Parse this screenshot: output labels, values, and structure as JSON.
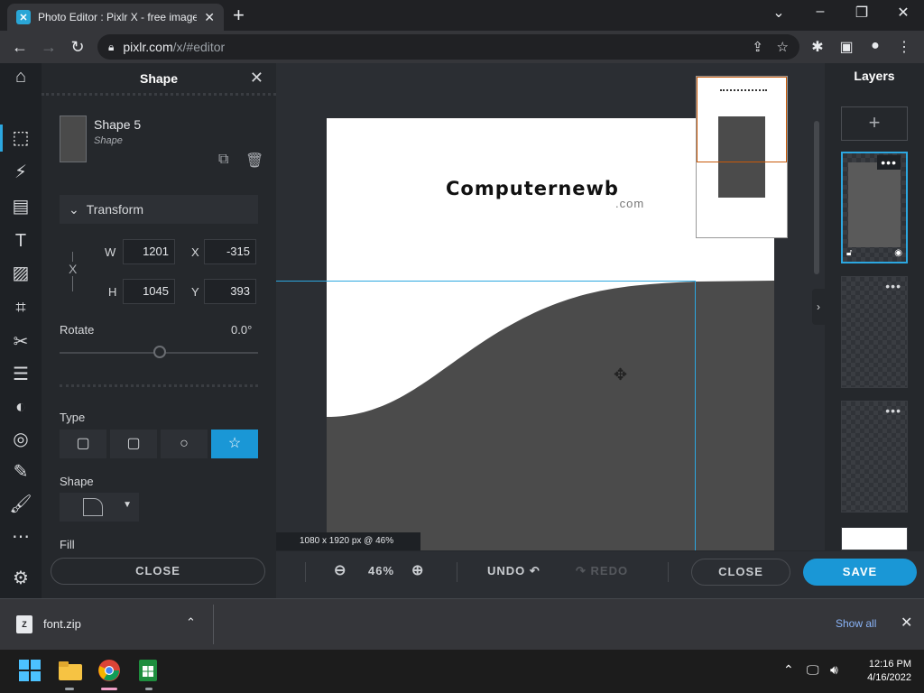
{
  "browser": {
    "tab_title": "Photo Editor : Pixlr X - free image",
    "url_host": "pixlr.com",
    "url_path": "/x/#editor"
  },
  "shape_panel": {
    "title": "Shape",
    "layer_name": "Shape 5",
    "layer_type": "Shape",
    "transform_label": "Transform",
    "w_label": "W",
    "w_value": "1201",
    "h_label": "H",
    "h_value": "1045",
    "x_label": "X",
    "x_value": "-315",
    "y_label": "Y",
    "y_value": "393",
    "link_label": "X",
    "rotate_label": "Rotate",
    "rotate_value": "0.0°",
    "type_label": "Type",
    "shape_label": "Shape",
    "fill_label": "Fill",
    "close_label": "CLOSE"
  },
  "canvas": {
    "logo_main": "Computernewb",
    "logo_sub": ".com",
    "size_info": "1080 x 1920 px @ 46%",
    "shape_color": "#4b4b4b",
    "selection_color": "#2ca7e0"
  },
  "bottom_bar": {
    "zoom": "46%",
    "undo": "UNDO",
    "redo": "REDO",
    "close": "CLOSE",
    "save": "SAVE"
  },
  "layers": {
    "title": "Layers",
    "add": "+"
  },
  "downloads": {
    "file_name": "font.zip",
    "file_icon_label": "Z",
    "show_all": "Show all"
  },
  "taskbar": {
    "time": "12:16 PM",
    "date": "4/16/2022"
  },
  "colors": {
    "accent": "#1a97d6",
    "panel": "#25282c"
  }
}
